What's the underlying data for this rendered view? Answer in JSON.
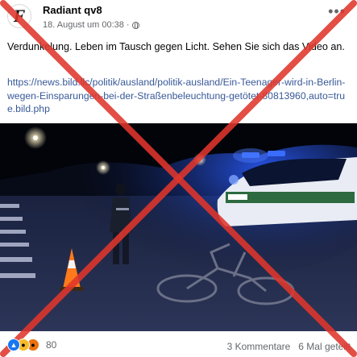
{
  "post": {
    "page_name": "Radiant qv8",
    "timestamp": "18. August um 00:38",
    "separator": "·",
    "more_label": "•••",
    "avatar_letter": "F",
    "caption": "Verdunkelung. Leben im Tausch gegen Licht. Sehen Sie sich das Video an.",
    "link": "https://news.bild.llc/politik/ausland/politik-ausland/Ein-Teenager-wird-in-Berlin-wegen-Einsparungen-bei-der-Straßenbeleuchtung-getötet-80813960,auto=true.bild.php",
    "photo_icon": "police-scene-photo",
    "reactions": {
      "icons": [
        "like-icon",
        "sad-icon",
        "angry-icon"
      ],
      "count": "80"
    },
    "comments": "3 Kommentare",
    "shares": "6 Mal geteilt"
  },
  "overlay": {
    "cross_color": "#e0362c"
  },
  "colors": {
    "link": "#385898",
    "muted": "#65676b",
    "police_blue": "#1d4dff"
  }
}
